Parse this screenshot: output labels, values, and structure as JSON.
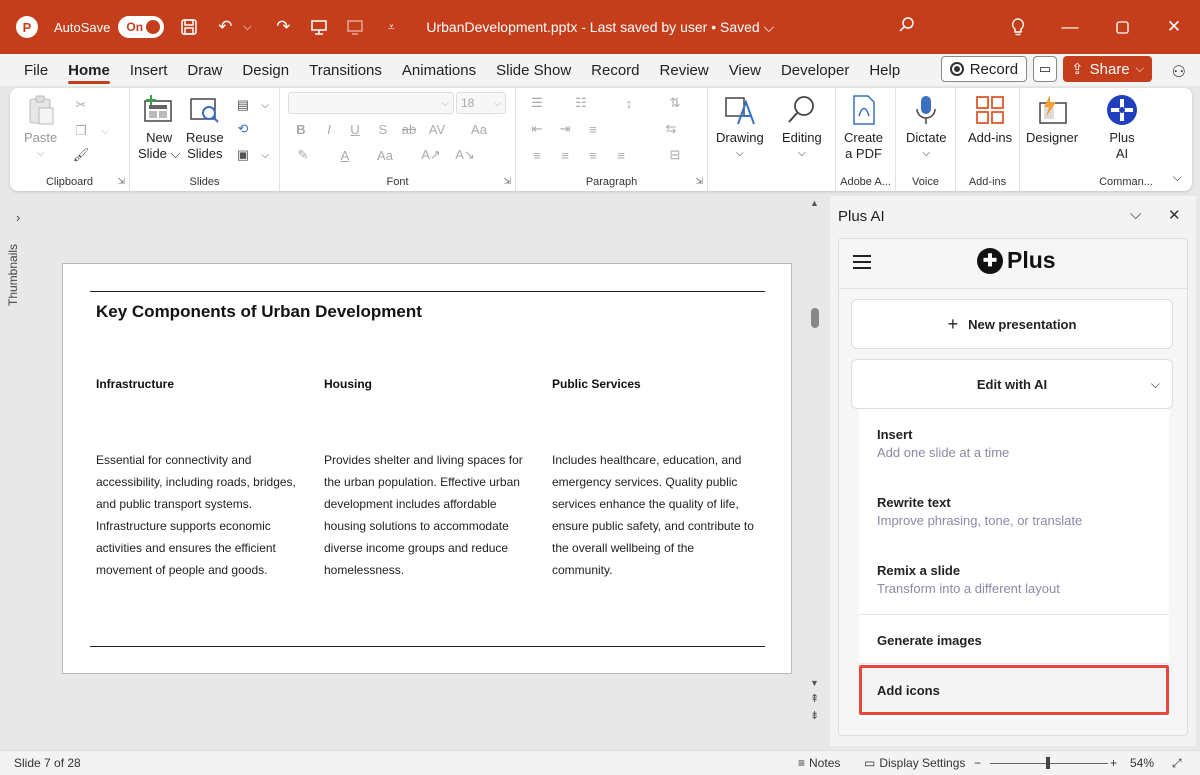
{
  "titlebar": {
    "logo": "P",
    "autosave_label": "AutoSave",
    "autosave_state": "On",
    "doc_title": "UrbanDevelopment.pptx  -  Last saved by user  •  Saved  ⌵",
    "accent": "#c43e1c"
  },
  "tabs": [
    "File",
    "Home",
    "Insert",
    "Draw",
    "Design",
    "Transitions",
    "Animations",
    "Slide Show",
    "Record",
    "Review",
    "View",
    "Developer",
    "Help"
  ],
  "active_tab": "Home",
  "tab_actions": {
    "record": "Record",
    "share": "Share"
  },
  "ribbon": {
    "clipboard": {
      "paste": "Paste",
      "label": "Clipboard"
    },
    "slides": {
      "new_slide_1": "New",
      "new_slide_2": "Slide ⌵",
      "reuse_1": "Reuse",
      "reuse_2": "Slides",
      "label": "Slides"
    },
    "font": {
      "size": "18",
      "label": "Font"
    },
    "paragraph": {
      "label": "Paragraph"
    },
    "drawing": {
      "line1": "Drawing",
      "line2": "⌵"
    },
    "editing": {
      "line1": "Editing",
      "line2": "⌵"
    },
    "adobe": {
      "line1": "Create",
      "line2": "a PDF",
      "label": "Adobe A..."
    },
    "voice": {
      "line1": "Dictate",
      "line2": "⌵",
      "label": "Voice"
    },
    "addins": {
      "line1": "Add-ins",
      "label": "Add-ins"
    },
    "designer": {
      "line1": "Designer"
    },
    "plusai": {
      "line1": "Plus",
      "line2": "AI",
      "label": "Comman..."
    }
  },
  "thumbnails_label": "Thumbnails",
  "slide": {
    "title": "Key Components of Urban Development",
    "columns": [
      {
        "heading": "Infrastructure",
        "lines": [
          "Essential for connectivity and",
          "accessibility, including roads, bridges,",
          "and public transport systems.",
          "Infrastructure supports economic",
          "activities and ensures the efficient",
          "movement of people and goods."
        ]
      },
      {
        "heading": "Housing",
        "lines": [
          "Provides shelter and living spaces for",
          "the urban population. Effective urban",
          "development includes affordable",
          "housing solutions to accommodate",
          "diverse income groups and reduce",
          "homelessness."
        ]
      },
      {
        "heading": "Public Services",
        "lines": [
          "Includes healthcare, education, and",
          "emergency services. Quality public",
          "services enhance the quality of life,",
          "ensure public safety, and contribute to",
          "the overall wellbeing of the",
          "community."
        ]
      }
    ]
  },
  "pane": {
    "title": "Plus AI",
    "brand": "Plus",
    "new_presentation": "New presentation",
    "edit_with_ai": "Edit with AI",
    "menu": [
      {
        "title": "Insert",
        "subtitle": "Add one slide at a time"
      },
      {
        "title": "Rewrite text",
        "subtitle": "Improve phrasing, tone, or translate"
      },
      {
        "title": "Remix a slide",
        "subtitle": "Transform into a different layout"
      },
      {
        "title": "Generate images",
        "subtitle": ""
      },
      {
        "title": "Add icons",
        "subtitle": ""
      }
    ],
    "highlight_color": "#e8473b"
  },
  "statusbar": {
    "slide_info": "Slide 7 of 28",
    "notes": "Notes",
    "display_settings": "Display Settings",
    "zoom": "54%"
  }
}
